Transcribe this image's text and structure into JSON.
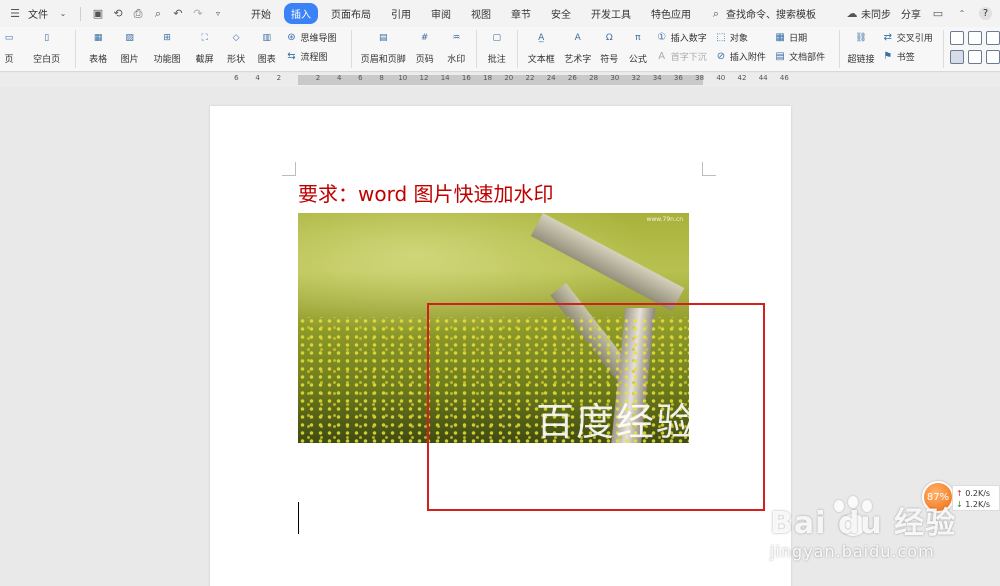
{
  "menubar": {
    "file_label": "文件",
    "tabs": [
      {
        "label": "开始",
        "active": false
      },
      {
        "label": "插入",
        "active": true
      },
      {
        "label": "页面布局",
        "active": false
      },
      {
        "label": "引用",
        "active": false
      },
      {
        "label": "审阅",
        "active": false
      },
      {
        "label": "视图",
        "active": false
      },
      {
        "label": "章节",
        "active": false
      },
      {
        "label": "安全",
        "active": false
      },
      {
        "label": "开发工具",
        "active": false
      },
      {
        "label": "特色应用",
        "active": false
      }
    ],
    "search_label": "查找命令、搜索模板",
    "sync_label": "未同步",
    "share_label": "分享",
    "help_label": "?"
  },
  "ribbon": {
    "page_label": "页",
    "blank_page_label": "空白页",
    "table_label": "表格",
    "picture_label": "图片",
    "function_chart_label": "功能图",
    "screenshot_label": "截屏",
    "shape_label": "形状",
    "chart_label": "图表",
    "mindmap_label": "思维导图",
    "flowchart_label": "流程图",
    "header_footer_label": "页眉和页脚",
    "page_number_label": "页码",
    "watermark_label": "水印",
    "comment_label": "批注",
    "textbox_label": "文本框",
    "wordart_label": "艺术字",
    "symbol_label": "符号",
    "formula_label": "公式",
    "insert_number_label": "插入数字",
    "object_label": "对象",
    "date_label": "日期",
    "drop_cap_label": "首字下沉",
    "insert_attachment_label": "插入附件",
    "doc_parts_label": "文档部件",
    "hyperlink_label": "超链接",
    "cross_ref_label": "交叉引用",
    "bookmark_label": "书签"
  },
  "ruler": {
    "left_numbers": [
      "6",
      "4",
      "2"
    ],
    "right_numbers": [
      "2",
      "4",
      "6",
      "8",
      "10",
      "12",
      "14",
      "16",
      "18",
      "20",
      "22",
      "24",
      "26",
      "28",
      "30",
      "32",
      "34",
      "36",
      "38",
      "40",
      "42",
      "44",
      "46"
    ]
  },
  "document": {
    "title": "要求：word 图片快速加水印",
    "image_watermark": "百度经验",
    "image_corner_mark": "www.79n.cn"
  },
  "speed_widget": {
    "percent": "87%",
    "upload": "0.2K/s",
    "download": "1.2K/s"
  },
  "overlay": {
    "brand": "Bai du 经验",
    "site": "jingyan.baidu.com"
  },
  "colors": {
    "accent_tab": "#3b82f6",
    "title_red": "#c00000",
    "highlight_box": "#d41f1f"
  }
}
